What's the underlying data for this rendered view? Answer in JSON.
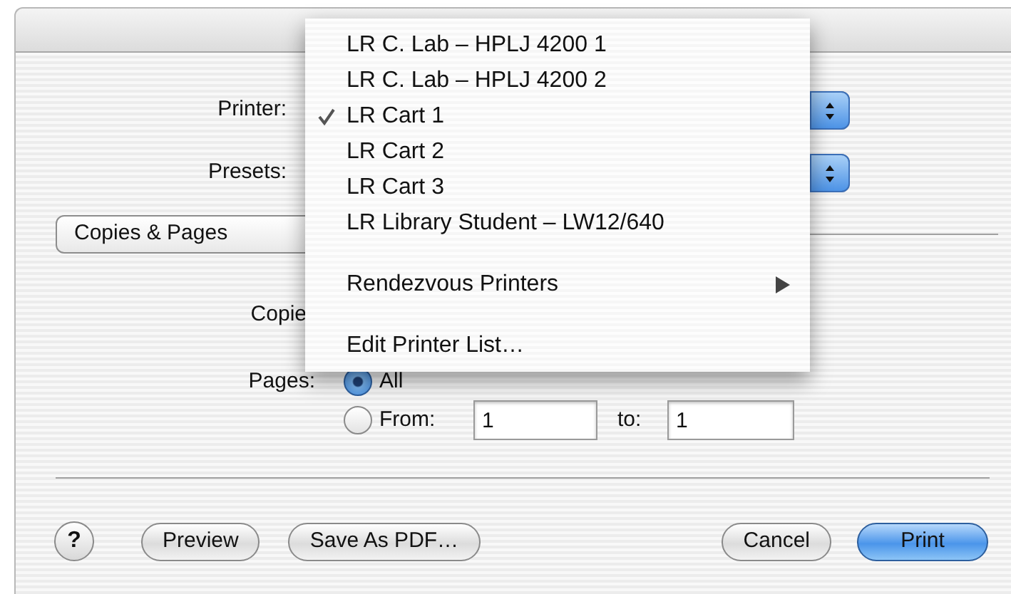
{
  "printer": {
    "label": "Printer:"
  },
  "presets": {
    "label": "Presets:"
  },
  "panel_popup": {
    "value": "Copies & Pages"
  },
  "copies": {
    "label": "Copie"
  },
  "pages": {
    "label": "Pages:",
    "options": [
      {
        "label": "All",
        "selected": true
      },
      {
        "label": "From:",
        "selected": false
      }
    ],
    "from": "1",
    "to_label": "to:",
    "to": "1"
  },
  "buttons": {
    "left": [
      {
        "kind": "help",
        "label": "?"
      },
      {
        "kind": "normal",
        "label": "Preview"
      },
      {
        "kind": "normal",
        "label": "Save As PDF…"
      }
    ],
    "right": [
      {
        "kind": "normal",
        "label": "Cancel"
      },
      {
        "kind": "default",
        "label": "Print"
      }
    ]
  },
  "printer_menu": {
    "items": [
      {
        "kind": "item",
        "label": "LR C. Lab – HPLJ 4200 1",
        "checked": false
      },
      {
        "kind": "item",
        "label": "LR C. Lab – HPLJ 4200 2",
        "checked": false
      },
      {
        "kind": "item",
        "label": "LR Cart 1",
        "checked": true
      },
      {
        "kind": "item",
        "label": "LR Cart 2",
        "checked": false
      },
      {
        "kind": "item",
        "label": "LR Cart 3",
        "checked": false
      },
      {
        "kind": "item",
        "label": "LR Library Student – LW12/640",
        "checked": false
      },
      {
        "kind": "separator"
      },
      {
        "kind": "submenu",
        "label": "Rendezvous Printers"
      },
      {
        "kind": "separator"
      },
      {
        "kind": "item",
        "label": "Edit Printer List…",
        "checked": false
      }
    ]
  }
}
